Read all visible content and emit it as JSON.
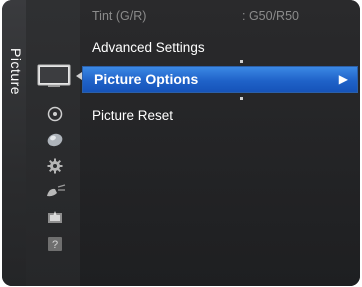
{
  "sidebar": {
    "title": "Picture",
    "icons": [
      "picture-icon",
      "sound-icon",
      "channel-icon",
      "setup-icon",
      "input-icon",
      "application-icon",
      "support-icon"
    ]
  },
  "menu": {
    "items": [
      {
        "label": "Tint (G/R)",
        "value": ": G50/R50",
        "state": "dimmed"
      },
      {
        "label": "Advanced Settings",
        "state": "normal"
      },
      {
        "label": "Picture Options",
        "state": "selected",
        "arrow": "▶"
      },
      {
        "label": "Picture Reset",
        "state": "normal"
      }
    ]
  },
  "colors": {
    "selection": "#1f62c8",
    "background": "#1e1f21",
    "dim_text": "#8b8b8b"
  }
}
